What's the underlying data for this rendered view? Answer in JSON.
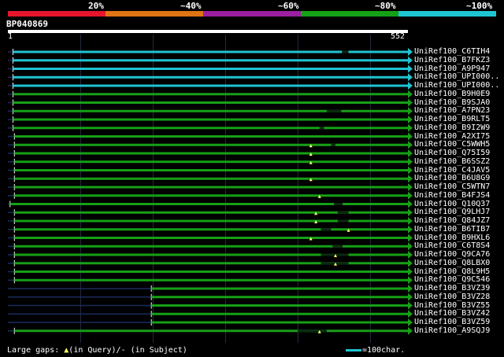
{
  "header": {
    "percent_labels": [
      "20%",
      "~40%",
      "~60%",
      "~80%",
      "~100%"
    ],
    "color_bands": [
      "#e5162c",
      "#e07414",
      "#9b1fa0",
      "#16a016",
      "#1fc4d2"
    ],
    "query_id": "BP040869",
    "query_start": "1",
    "query_end": "552"
  },
  "colors": {
    "cyan": "#1fc4d2",
    "green": "#16a016",
    "gap": "#0a2a10",
    "unaligned": "#1a2c5c",
    "marker": "#ffff66"
  },
  "hits": [
    {
      "name": "UniRef100_C6TIH4",
      "color": "cyan",
      "start": 7,
      "end": 552,
      "gap": [
        461,
        470
      ]
    },
    {
      "name": "UniRef100_B7FKZ3",
      "color": "cyan",
      "start": 7,
      "end": 552
    },
    {
      "name": "UniRef100_A9P947",
      "color": "cyan",
      "start": 7,
      "end": 552
    },
    {
      "name": "UniRef100_UPI000..",
      "color": "cyan",
      "start": 7,
      "end": 552
    },
    {
      "name": "UniRef100_UPI000..",
      "color": "cyan",
      "start": 7,
      "end": 552
    },
    {
      "name": "UniRef100_B9H0E9",
      "color": "green",
      "start": 7,
      "end": 552
    },
    {
      "name": "UniRef100_B9SJA0",
      "color": "green",
      "start": 7,
      "end": 552
    },
    {
      "name": "UniRef100_A7PN23",
      "color": "green",
      "start": 7,
      "end": 552,
      "gap": [
        440,
        460
      ]
    },
    {
      "name": "UniRef100_B9RLT5",
      "color": "green",
      "start": 7,
      "end": 552
    },
    {
      "name": "UniRef100_B9I2W9",
      "color": "green",
      "start": 7,
      "end": 552,
      "gap": [
        430,
        436
      ]
    },
    {
      "name": "UniRef100_A2XI75",
      "color": "green",
      "start": 9,
      "end": 552
    },
    {
      "name": "UniRef100_C5WWH5",
      "color": "green",
      "start": 9,
      "end": 552,
      "marker": 418,
      "gap": [
        446,
        452
      ]
    },
    {
      "name": "UniRef100_Q75I59",
      "color": "green",
      "start": 9,
      "end": 552,
      "marker": 418
    },
    {
      "name": "UniRef100_B6SSZ2",
      "color": "green",
      "start": 9,
      "end": 552,
      "marker": 418
    },
    {
      "name": "UniRef100_C4JAV5",
      "color": "green",
      "start": 9,
      "end": 552
    },
    {
      "name": "UniRef100_B6U8G9",
      "color": "green",
      "start": 9,
      "end": 552,
      "marker": 418
    },
    {
      "name": "UniRef100_C5WTN7",
      "color": "green",
      "start": 9,
      "end": 552
    },
    {
      "name": "UniRef100_B4FJS4",
      "color": "green",
      "start": 9,
      "end": 552,
      "marker": 430
    },
    {
      "name": "UniRef100_Q10Q37",
      "color": "green",
      "start": 3,
      "end": 552,
      "gap": [
        450,
        462
      ]
    },
    {
      "name": "UniRef100_Q9LHJ7",
      "color": "green",
      "start": 9,
      "end": 552,
      "marker": 425,
      "gap": [
        455,
        470
      ]
    },
    {
      "name": "UniRef100_Q84JZ7",
      "color": "green",
      "start": 9,
      "end": 552,
      "marker": 425,
      "gap": [
        455,
        470
      ]
    },
    {
      "name": "UniRef100_B6TIB7",
      "color": "green",
      "start": 9,
      "end": 552,
      "marker": 470,
      "gap": [
        432,
        446
      ]
    },
    {
      "name": "UniRef100_B9HXL6",
      "color": "green",
      "start": 9,
      "end": 552,
      "marker": 418
    },
    {
      "name": "UniRef100_C6T8S4",
      "color": "green",
      "start": 9,
      "end": 552,
      "gap": [
        448,
        462
      ]
    },
    {
      "name": "UniRef100_Q9CA76",
      "color": "green",
      "start": 9,
      "end": 552,
      "marker": 452,
      "gap": [
        432,
        470
      ]
    },
    {
      "name": "UniRef100_Q8LBX0",
      "color": "green",
      "start": 9,
      "end": 552,
      "marker": 452,
      "gap": [
        432,
        470
      ]
    },
    {
      "name": "UniRef100_Q8L9H5",
      "color": "green",
      "start": 9,
      "end": 552
    },
    {
      "name": "UniRef100_Q9C546",
      "color": "green",
      "start": 9,
      "end": 552
    },
    {
      "name": "UniRef100_B3VZ39",
      "color": "green",
      "start": 198,
      "end": 552
    },
    {
      "name": "UniRef100_B3VZ28",
      "color": "green",
      "start": 198,
      "end": 552
    },
    {
      "name": "UniRef100_B3VZ55",
      "color": "green",
      "start": 198,
      "end": 552
    },
    {
      "name": "UniRef100_B3VZ42",
      "color": "green",
      "start": 198,
      "end": 552
    },
    {
      "name": "UniRef100_B3VZ59",
      "color": "green",
      "start": 198,
      "end": 552
    },
    {
      "name": "UniRef100_A9SQJ9",
      "color": "green",
      "start": 9,
      "end": 552,
      "marker": 430,
      "gap": [
        400,
        440
      ]
    }
  ],
  "legend": {
    "prefix": "Large gaps:",
    "query_marker": "▲",
    "query_text": "(in Query)/",
    "subject_marker": "-",
    "subject_text": " (in Subject)",
    "scale_text": "=100char."
  }
}
